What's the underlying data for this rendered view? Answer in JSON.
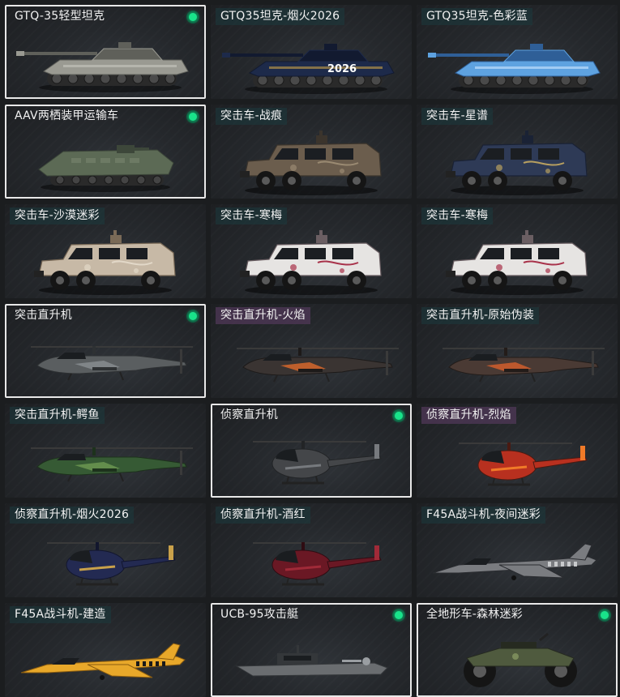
{
  "vehicles": [
    {
      "label": "GTQ-35轻型坦克",
      "type": "tank",
      "selected": true,
      "equipped": true,
      "label_style": "plain",
      "colors": {
        "body": "#9a9a92",
        "dark": "#5f605a",
        "accent": "#c8c8c0"
      }
    },
    {
      "label": "GTQ35坦克-烟火2026",
      "type": "tank",
      "selected": false,
      "equipped": false,
      "label_style": "teal",
      "badge_text": "2026",
      "colors": {
        "body": "#1d2a4a",
        "dark": "#121a30",
        "accent": "#c9a14a"
      }
    },
    {
      "label": "GTQ35坦克-色彩蓝",
      "type": "tank",
      "selected": false,
      "equipped": false,
      "label_style": "teal",
      "colors": {
        "body": "#5ea2e0",
        "dark": "#2f5f97",
        "accent": "#cfe6ff"
      }
    },
    {
      "label": "AAV两栖装甲运输车",
      "type": "amphibious",
      "selected": true,
      "equipped": true,
      "label_style": "plain",
      "colors": {
        "body": "#5c6a55",
        "dark": "#3d473a",
        "accent": "#7e8a74"
      }
    },
    {
      "label": "突击车-战痕",
      "type": "assault",
      "selected": false,
      "equipped": false,
      "label_style": "teal",
      "colors": {
        "body": "#6b5d4d",
        "dark": "#3b342c",
        "accent": "#9a8a72"
      }
    },
    {
      "label": "突击车-星谱",
      "type": "assault",
      "selected": false,
      "equipped": false,
      "label_style": "teal",
      "colors": {
        "body": "#2e3a56",
        "dark": "#1a2235",
        "accent": "#b8a060"
      }
    },
    {
      "label": "突击车-沙漠迷彩",
      "type": "assault",
      "selected": false,
      "equipped": false,
      "label_style": "teal",
      "colors": {
        "body": "#c7b9a6",
        "dark": "#7a6a57",
        "accent": "#e2d8c8"
      }
    },
    {
      "label": "突击车-寒梅",
      "type": "assault",
      "selected": false,
      "equipped": false,
      "label_style": "teal",
      "colors": {
        "body": "#e6e4e2",
        "dark": "#6a5e62",
        "accent": "#a8324a"
      }
    },
    {
      "label": "突击车-寒梅",
      "type": "assault",
      "selected": false,
      "equipped": false,
      "label_style": "teal",
      "colors": {
        "body": "#e6e4e2",
        "dark": "#6a5e62",
        "accent": "#a8324a"
      }
    },
    {
      "label": "突击直升机",
      "type": "attack_heli",
      "selected": true,
      "equipped": true,
      "label_style": "plain",
      "colors": {
        "body": "#5a5e60",
        "dark": "#2e3133",
        "accent": "#8a8f92"
      }
    },
    {
      "label": "突击直升机-火焰",
      "type": "attack_heli",
      "selected": false,
      "equipped": false,
      "label_style": "purple",
      "colors": {
        "body": "#3a3432",
        "dark": "#1d1a19",
        "accent": "#e06a2a"
      }
    },
    {
      "label": "突击直升机-原始伪装",
      "type": "attack_heli",
      "selected": false,
      "equipped": false,
      "label_style": "teal",
      "colors": {
        "body": "#4a3a34",
        "dark": "#231c19",
        "accent": "#d8602c"
      }
    },
    {
      "label": "突击直升机-鳄鱼",
      "type": "attack_heli",
      "selected": false,
      "equipped": false,
      "label_style": "teal",
      "colors": {
        "body": "#365a34",
        "dark": "#1d321c",
        "accent": "#6f9a52"
      }
    },
    {
      "label": "侦察直升机",
      "type": "scout_heli",
      "selected": true,
      "equipped": true,
      "label_style": "plain",
      "colors": {
        "body": "#444649",
        "dark": "#222426",
        "accent": "#777a7e"
      }
    },
    {
      "label": "侦察直升机-烈焰",
      "type": "scout_heli",
      "selected": false,
      "equipped": false,
      "label_style": "purple",
      "colors": {
        "body": "#b8301f",
        "dark": "#4a1a12",
        "accent": "#f07a28"
      }
    },
    {
      "label": "侦察直升机-烟火2026",
      "type": "scout_heli",
      "selected": false,
      "equipped": false,
      "label_style": "teal",
      "colors": {
        "body": "#232a52",
        "dark": "#12162e",
        "accent": "#c9a14a"
      }
    },
    {
      "label": "侦察直升机-酒红",
      "type": "scout_heli",
      "selected": false,
      "equipped": false,
      "label_style": "teal",
      "colors": {
        "body": "#6a1824",
        "dark": "#2f0c12",
        "accent": "#a02a38"
      }
    },
    {
      "label": "F45A战斗机-夜间迷彩",
      "type": "jet",
      "selected": false,
      "equipped": false,
      "label_style": "teal",
      "colors": {
        "body": "#7a7c80",
        "dark": "#2a2c30",
        "accent": "#c8cacc"
      }
    },
    {
      "label": "F45A战斗机-建造",
      "type": "jet",
      "selected": false,
      "equipped": false,
      "label_style": "teal",
      "colors": {
        "body": "#e8a82a",
        "dark": "#8a5c10",
        "accent": "#1a1a1a"
      }
    },
    {
      "label": "UCB-95攻击艇",
      "type": "boat",
      "selected": true,
      "equipped": true,
      "label_style": "plain",
      "colors": {
        "body": "#6a6d70",
        "dark": "#34373a",
        "accent": "#9a9ea2"
      }
    },
    {
      "label": "全地形车-森林迷彩",
      "type": "atv",
      "selected": true,
      "equipped": true,
      "label_style": "plain",
      "colors": {
        "body": "#4f5a3e",
        "dark": "#262a20",
        "accent": "#7a8a5a"
      }
    }
  ]
}
